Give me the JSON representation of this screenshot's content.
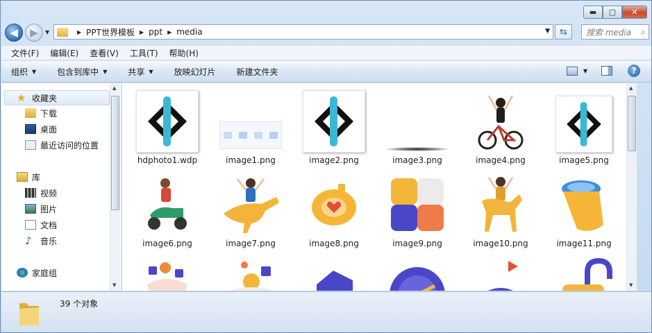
{
  "window": {
    "caption": {
      "min": "▬",
      "max": "▢",
      "close": "✕"
    }
  },
  "nav": {
    "back_glyph": "◀",
    "forward_glyph": "▶",
    "breadcrumbs": [
      "PPT世界模板",
      "ppt",
      "media"
    ],
    "search_placeholder": "搜索 media"
  },
  "menubar": {
    "items": [
      "文件(F)",
      "编辑(E)",
      "查看(V)",
      "工具(T)",
      "帮助(H)"
    ]
  },
  "toolbar": {
    "organize": "组织",
    "include_in_library": "包含到库中",
    "share": "共享",
    "slideshow": "放映幻灯片",
    "new_folder": "新建文件夹"
  },
  "navpane": {
    "favorites": "收藏夹",
    "downloads": "下载",
    "desktop": "桌面",
    "recent": "最近访问的位置",
    "libraries": "库",
    "videos": "视频",
    "pictures": "图片",
    "documents": "文档",
    "music": "音乐",
    "homegroup": "家庭组"
  },
  "files": [
    {
      "name": "hdphoto1.wdp",
      "thumb": "logo-icon"
    },
    {
      "name": "image1.png",
      "thumb": "slides-icon"
    },
    {
      "name": "image2.png",
      "thumb": "logo-icon"
    },
    {
      "name": "image3.png",
      "thumb": "shadow-icon"
    },
    {
      "name": "image4.png",
      "thumb": "bike-rider-icon"
    },
    {
      "name": "image5.png",
      "thumb": "logo-icon"
    },
    {
      "name": "image6.png",
      "thumb": "scooter-rider-icon"
    },
    {
      "name": "image7.png",
      "thumb": "dino-rider-icon"
    },
    {
      "name": "image8.png",
      "thumb": "heart-ring-icon"
    },
    {
      "name": "image9.png",
      "thumb": "cube-blocks-icon"
    },
    {
      "name": "image10.png",
      "thumb": "horse-rider-icon"
    },
    {
      "name": "image11.png",
      "thumb": "cup-icon"
    },
    {
      "name": "",
      "thumb": "shapes-icon"
    },
    {
      "name": "",
      "thumb": "ball-cup-icon"
    },
    {
      "name": "",
      "thumb": "purple-block-icon"
    },
    {
      "name": "",
      "thumb": "dial-icon"
    },
    {
      "name": "",
      "thumb": "spinning-top-icon"
    },
    {
      "name": "",
      "thumb": "lock-icon"
    }
  ],
  "status": {
    "count": "39 个对象"
  },
  "colors": {
    "logo_cyan": "#3bb8d3",
    "logo_black": "#111111",
    "accent_yellow": "#f3b63a",
    "accent_purple": "#4a46c8"
  }
}
